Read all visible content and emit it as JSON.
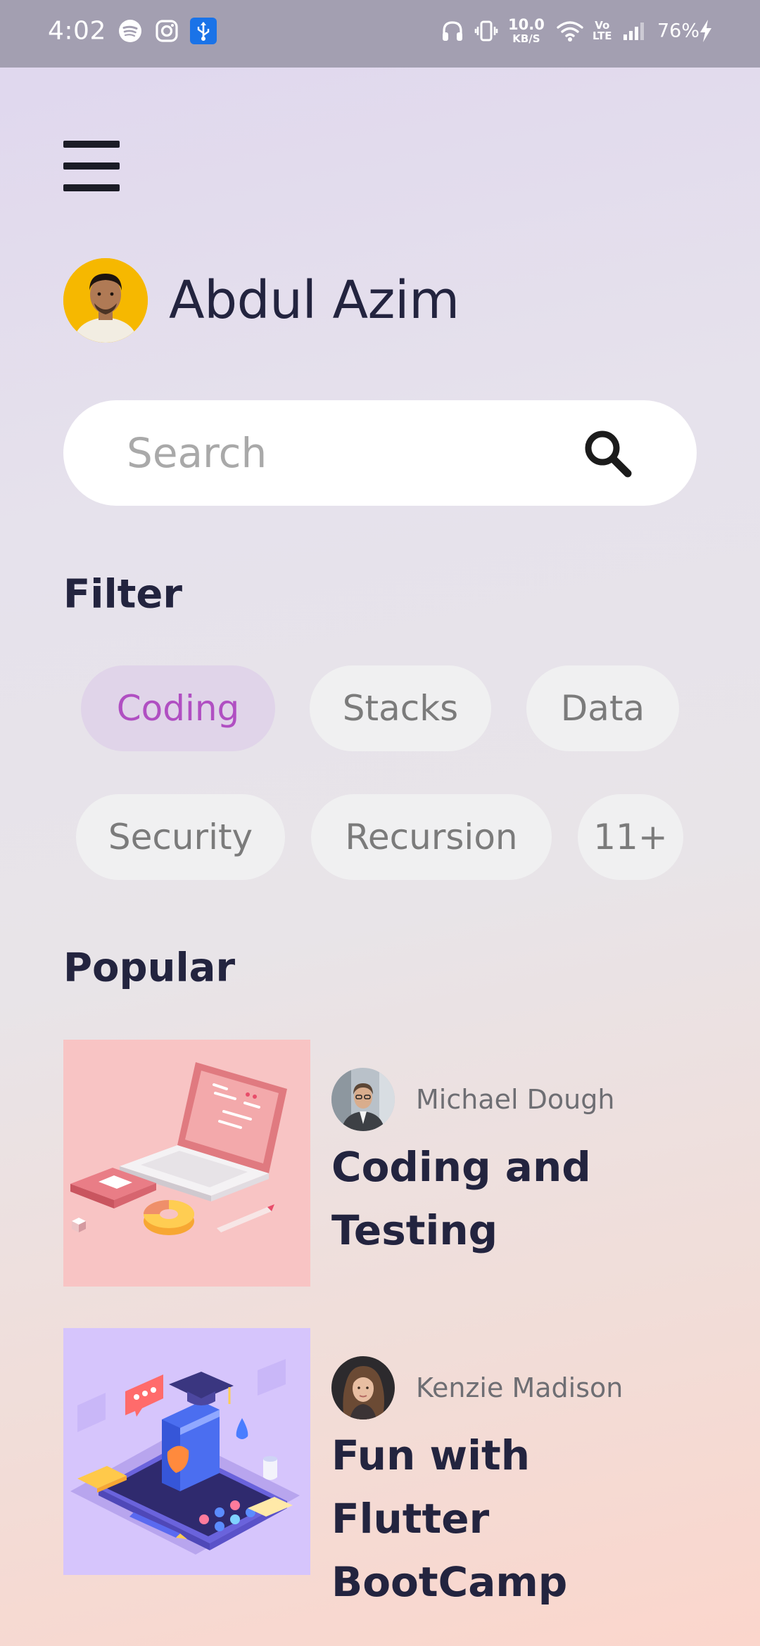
{
  "status_bar": {
    "time": "4:02",
    "left_icons": [
      "spotify-icon",
      "instagram-icon",
      "usb-icon"
    ],
    "net_speed_value": "10.0",
    "net_speed_unit": "KB/S",
    "volte_top": "Vo",
    "volte_bottom": "LTE",
    "battery": "76%",
    "right_icons": [
      "headphones-icon",
      "vibrate-icon",
      "wifi-icon",
      "signal-icon",
      "charging-icon"
    ]
  },
  "header": {
    "menu_icon": "hamburger-menu-icon",
    "user_name": "Abdul Azim"
  },
  "search": {
    "placeholder": "Search",
    "value": "",
    "icon": "search-icon"
  },
  "filter": {
    "title": "Filter",
    "chips": [
      {
        "label": "Coding",
        "active": true
      },
      {
        "label": "Stacks",
        "active": false
      },
      {
        "label": "Data",
        "active": false
      },
      {
        "label": "Security",
        "active": false
      },
      {
        "label": "Recursion",
        "active": false
      },
      {
        "label": "11+",
        "active": false
      }
    ]
  },
  "popular": {
    "title": "Popular",
    "courses": [
      {
        "author": "Michael Dough",
        "title_line1": "Coding and",
        "title_line2": "Testing",
        "thumb_color": "#f8c4c4",
        "thumb_icon": "laptop-illustration-icon"
      },
      {
        "author": "Kenzie Madison",
        "title_line1": "Fun with Flutter",
        "title_line2": "BootCamp",
        "thumb_color": "#d6c5fc",
        "thumb_icon": "mobile-learning-illustration-icon"
      }
    ]
  },
  "colors": {
    "primary_text": "#23243f",
    "chip_active_text": "#b04fc2",
    "chip_active_bg": "#e0d4e9",
    "chip_bg": "#f0f0f1",
    "status_bar_bg": "#a39fb1"
  }
}
